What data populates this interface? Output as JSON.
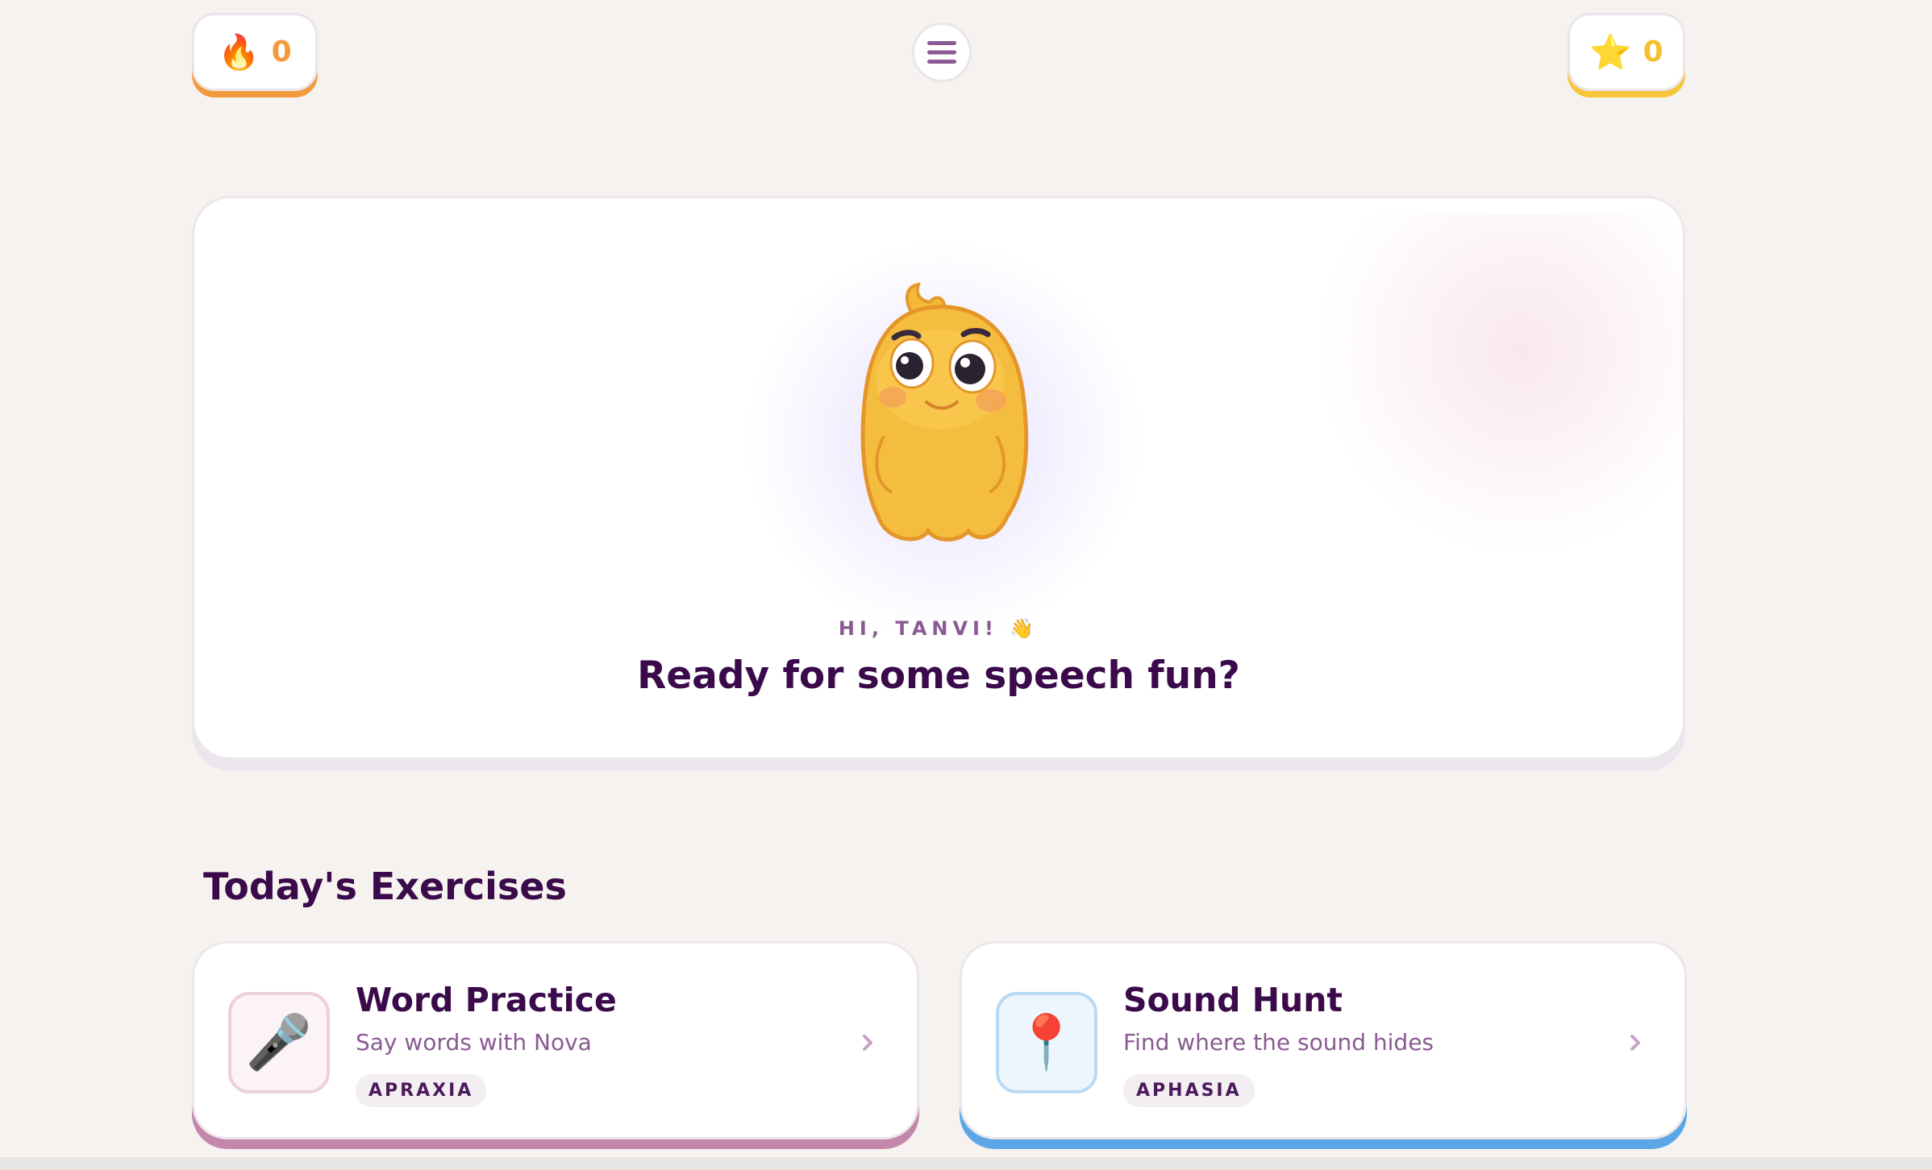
{
  "streak": {
    "icon": "fire-icon",
    "count": "0",
    "emoji": "🔥",
    "accent": "#f39a3c"
  },
  "stars": {
    "icon": "star-icon",
    "count": "0",
    "emoji": "⭐",
    "accent": "#f7c638"
  },
  "menu": {
    "icon": "hamburger-menu-icon"
  },
  "hero": {
    "greeting": "HI, TANVI! 👋",
    "title": "Ready for some speech fun?"
  },
  "exercises": {
    "title": "Today's Exercises",
    "items": [
      {
        "title": "Word Practice",
        "subtitle": "Say words with Nova",
        "tag": "APRAXIA",
        "icon": "microphone-icon",
        "emoji": "🎤",
        "accent": "#c387ab"
      },
      {
        "title": "Sound Hunt",
        "subtitle": "Find where the sound hides",
        "tag": "APHASIA",
        "icon": "pushpin-icon",
        "emoji": "📍",
        "accent": "#5aa6e6"
      }
    ]
  },
  "colors": {
    "background": "#f6f2ef",
    "heading": "#3a0a4a",
    "muted": "#8a5a92"
  }
}
